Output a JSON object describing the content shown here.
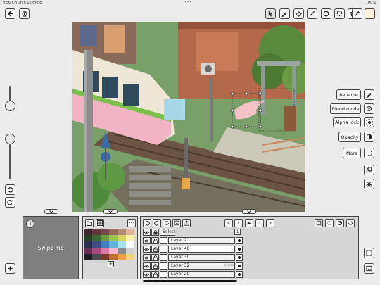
{
  "status_bar": {
    "time": "9:56 CH   Th 6 16 thg 8",
    "dots": "•••",
    "battery": "100%"
  },
  "side_actions": {
    "rename": "Rename",
    "blend_mode": "Blend mode",
    "alpha_lock": "Alpha lock",
    "opacity": "Opacity",
    "more": "More"
  },
  "preview": {
    "info_label": "i",
    "swipe_label": "Swipe me"
  },
  "palette": {
    "more_label": "•••",
    "add_label": "+",
    "colors": [
      "#3a2a2e",
      "#5b3a3f",
      "#7a4b4a",
      "#9c6a5c",
      "#b38a73",
      "#e1b59a",
      "#264025",
      "#3d6b34",
      "#6a9b3e",
      "#9bc24e",
      "#d8d35d",
      "#f6f0a8",
      "#2b2f4d",
      "#404d87",
      "#3f7fc0",
      "#61b5dd",
      "#a8e2ee",
      "#ffffff",
      "#6b2e58",
      "#a84a7d",
      "#e07aa7",
      "#f7b7cf",
      "#8a8a8a",
      "#cfcfcf",
      "#1e1e22",
      "#4b4b52",
      "#7a3a2a",
      "#c26c2e",
      "#eca146",
      "#f5d47a"
    ]
  },
  "layers": {
    "select_label": "Select",
    "frame_number": "1",
    "rows": [
      {
        "name": "Layer 2",
        "extra": ""
      },
      {
        "name": "Layer 48",
        "extra": ""
      },
      {
        "name": "Layer 30",
        "extra": ""
      },
      {
        "name": "Layer 32",
        "extra": "○○○"
      },
      {
        "name": "Layer 29",
        "extra": ""
      }
    ],
    "nav": [
      "«",
      "‹",
      "▶",
      "›",
      "»"
    ]
  },
  "icons": {
    "top_tools": [
      "select-arrow-icon",
      "pencil-icon",
      "eraser-icon",
      "line-icon",
      "circle-icon",
      "rect-select-icon",
      "fill-bucket-icon",
      "eyedropper-icon",
      "color-swatch-icon"
    ],
    "accent": "#f5c2c7"
  }
}
